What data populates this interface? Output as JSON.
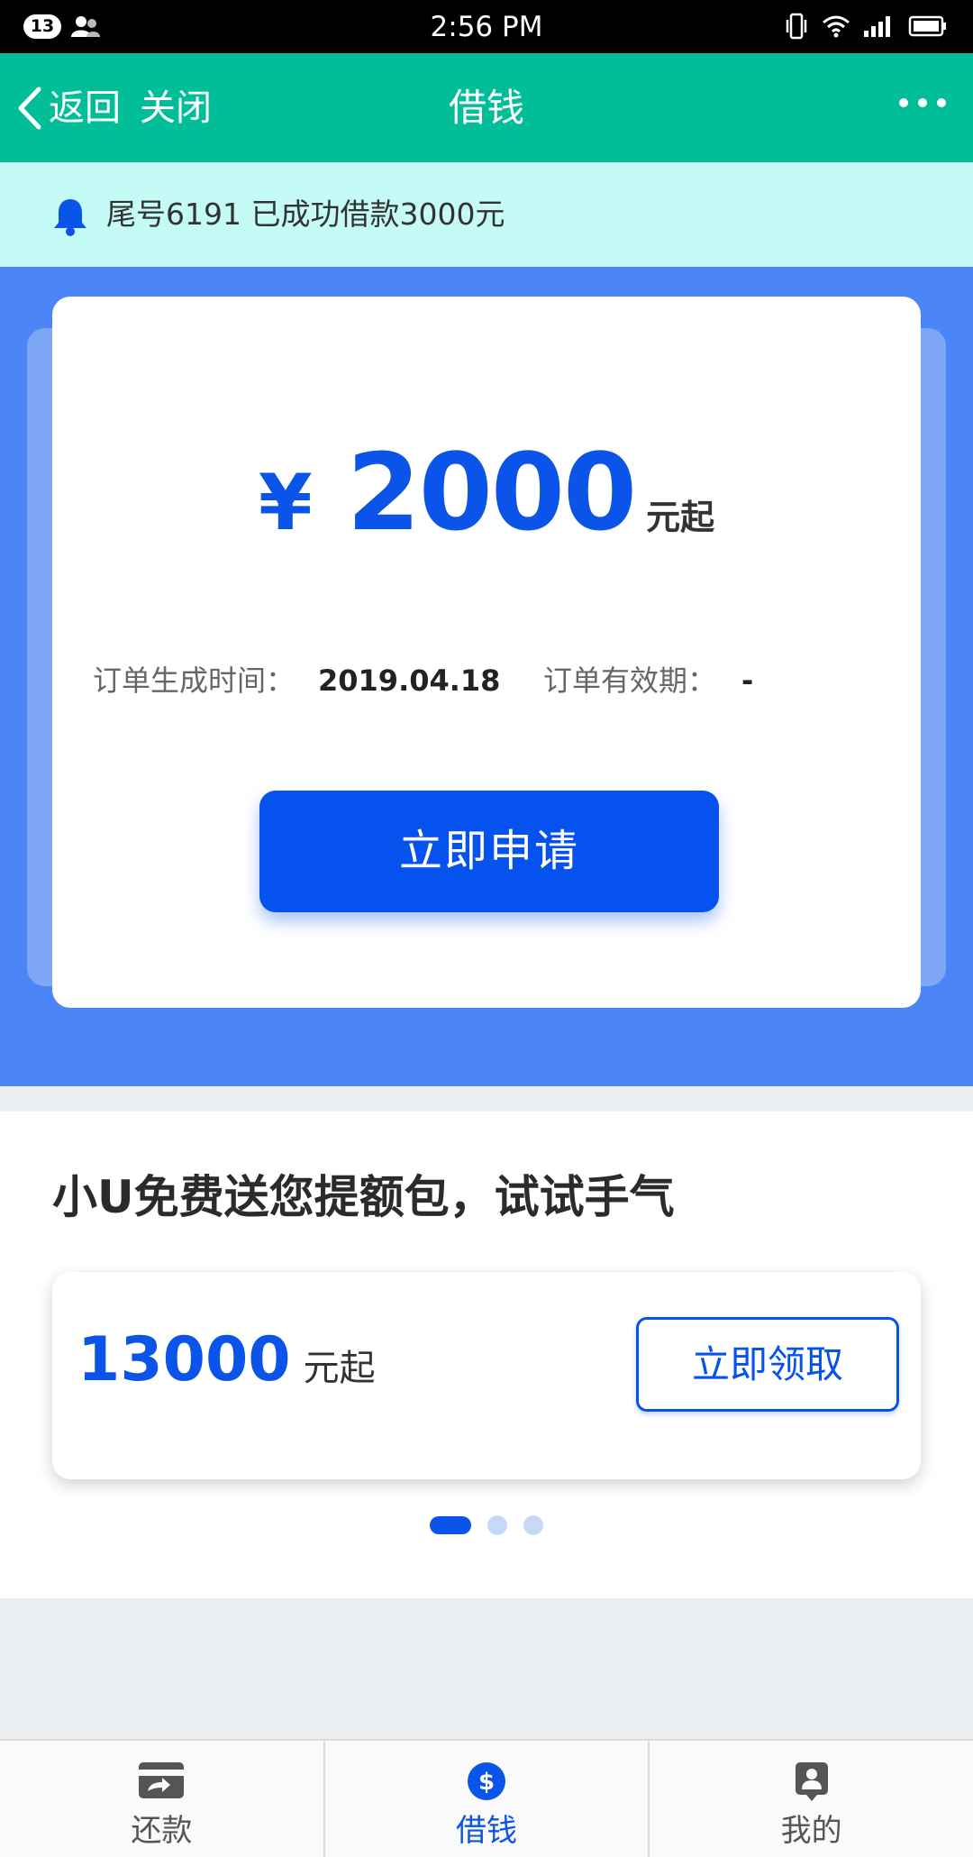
{
  "status_bar": {
    "notification_count": "13",
    "time": "2:56 PM"
  },
  "nav": {
    "back_label": "返回",
    "close_label": "关闭",
    "title": "借钱"
  },
  "notice": {
    "text": "尾号6191 已成功借款3000元"
  },
  "loan_card": {
    "currency_symbol": "¥",
    "amount": "2000",
    "unit": "元起",
    "created_label": "订单生成时间：",
    "created_value": "2019.04.18",
    "valid_label": "订单有效期：",
    "valid_value": "-",
    "apply_label": "立即申请"
  },
  "promo": {
    "title": "小U免费送您提额包，试试手气",
    "amount": "13000",
    "unit": "元起",
    "claim_label": "立即领取",
    "pager": {
      "pages": 3,
      "active_index": 0
    }
  },
  "tabs": [
    {
      "label": "还款",
      "icon": "repay-card-icon",
      "active": false
    },
    {
      "label": "借钱",
      "icon": "dollar-circle-icon",
      "active": true
    },
    {
      "label": "我的",
      "icon": "profile-icon",
      "active": false
    }
  ],
  "colors": {
    "nav_green": "#00be98",
    "notice_bg": "#c4fbf7",
    "hero_blue": "#4c85f6",
    "primary_blue": "#0552ee"
  }
}
